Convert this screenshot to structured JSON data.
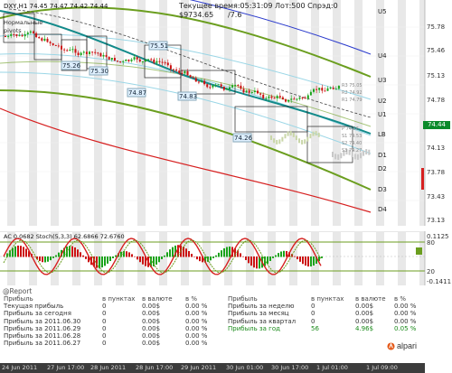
{
  "header": {
    "symbol_line": "DXY,H1  74.45 74.47 74.42 74.44",
    "normal": "Нормальные",
    "pivots": "pivots",
    "time_label": "Текущее время:05:31:09 Лот:500 Спрэд:0",
    "balance": "$9734.65",
    "extra": "/7.6"
  },
  "price_labels": [
    "75.26",
    "75.30",
    "75.51",
    "74.87",
    "74.83",
    "74.26"
  ],
  "pivot_labels": [
    "U5",
    "U4",
    "U3",
    "U2",
    "U1",
    "LB",
    "D1",
    "D2",
    "D3",
    "D4"
  ],
  "small_levels": [
    "R3 75.05",
    "R2 74.92",
    "R1 74.79",
    "P 74.66",
    "S1 74.53",
    "S2 74.40",
    "S3 74.27"
  ],
  "right_axis": [
    "75.78",
    "75.46",
    "75.13",
    "74.78",
    "74.44",
    "74.13",
    "73.78",
    "73.43",
    "73.13"
  ],
  "current_price": "74.44",
  "indicator": {
    "label": "AC 0.0682  Stoch(5,3,3) 62.6866 72.6760",
    "axis": [
      "0.1125",
      "80",
      "20",
      "-0.1411"
    ]
  },
  "report": {
    "title": "@Report",
    "left_table": {
      "headers": [
        "Прибыль",
        "в пунктах",
        "в валюте",
        "в %"
      ],
      "rows": [
        [
          "Текущая прибыль",
          "0",
          "0.00$",
          "0.00 %"
        ],
        [
          "Прибыль за сегодня",
          "0",
          "0.00$",
          "0.00 %"
        ],
        [
          "Прибыль за 2011.06.30",
          "0",
          "0.00$",
          "0.00 %"
        ],
        [
          "Прибыль за 2011.06.29",
          "0",
          "0.00$",
          "0.00 %"
        ],
        [
          "Прибыль за 2011.06.28",
          "0",
          "0.00$",
          "0.00 %"
        ],
        [
          "Прибыль за 2011.06.27",
          "0",
          "0.00$",
          "0.00 %"
        ]
      ]
    },
    "right_table": {
      "headers": [
        "Прибыль",
        "в пунктах",
        "в валюте",
        "в %"
      ],
      "rows": [
        [
          "Прибыль за неделю",
          "0",
          "0.00$",
          "0.00 %"
        ],
        [
          "Прибыль за месяц",
          "0",
          "0.00$",
          "0.00 %"
        ],
        [
          "Прибыль за квартал",
          "0",
          "0.00$",
          "0.00 %"
        ],
        [
          "Прибыль за год",
          "56",
          "4.96$",
          "0.05 %"
        ]
      ]
    }
  },
  "time_axis": [
    "24 Jun 2011",
    "27 Jun 17:00",
    "28 Jun 2011",
    "28 Jun 17:00",
    "29 Jun 2011",
    "30 Jun 01:00",
    "30 Jun 17:00",
    "1 Jul 01:00",
    "1 Jul 09:00"
  ],
  "brand": "alpari",
  "colors": {
    "up": "#1aa31a",
    "down": "#cc1111",
    "ma": "#128a8a",
    "channel": "#6b9e1f",
    "red": "#d62020",
    "blue": "#2a3acc"
  }
}
